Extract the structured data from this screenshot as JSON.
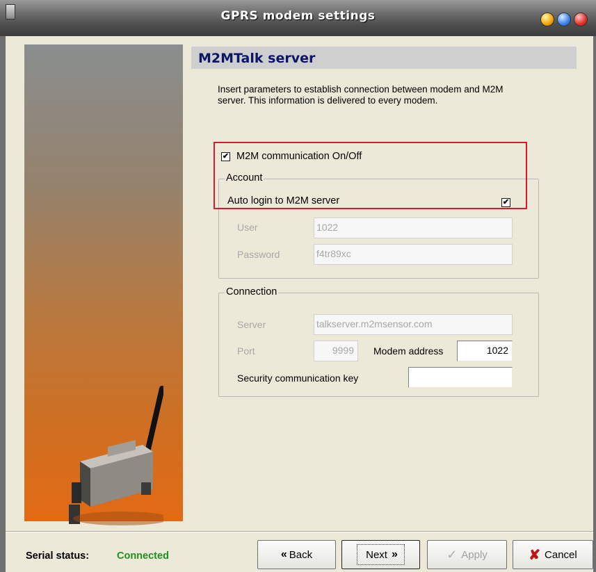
{
  "window": {
    "title": "GPRS modem settings"
  },
  "header": {
    "title": "M2MTalk server"
  },
  "description": "Insert parameters to establish connection between modem and M2M server. This information is delivered to every modem.",
  "m2m_toggle": {
    "label": "M2M communication On/Off",
    "checked": true,
    "mark": "✔"
  },
  "account": {
    "legend": "Account",
    "auto_login_label": "Auto login to M2M server",
    "auto_login_mark": "✔",
    "user_label": "User",
    "user_value": "1022",
    "password_label": "Password",
    "password_value": "f4tr89xc"
  },
  "connection": {
    "legend": "Connection",
    "server_label": "Server",
    "server_value": "talkserver.m2msensor.com",
    "port_label": "Port",
    "port_value": "9999",
    "modem_address_label": "Modem address",
    "modem_address_value": "1022",
    "security_key_label": "Security communication key",
    "security_key_value": ""
  },
  "status": {
    "label": "Serial status:",
    "value": "Connected",
    "value_color": "#1f8f1f"
  },
  "buttons": {
    "back": "Back",
    "back_icon": "«",
    "next": "Next",
    "next_icon": "»",
    "apply": "Apply",
    "apply_icon": "✓",
    "cancel": "Cancel",
    "cancel_icon": "✘"
  }
}
